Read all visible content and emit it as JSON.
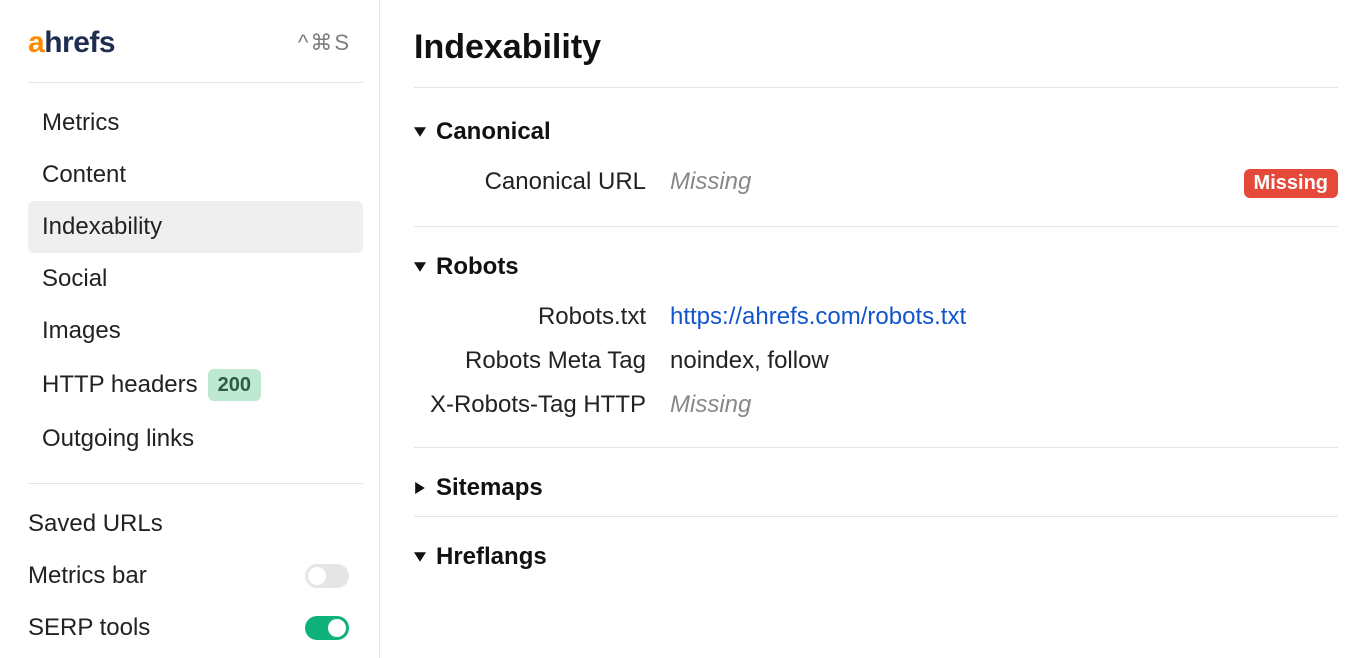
{
  "sidebar": {
    "shortcut_hint": "^⌘S",
    "items": [
      {
        "label": "Metrics",
        "active": false
      },
      {
        "label": "Content",
        "active": false
      },
      {
        "label": "Indexability",
        "active": true
      },
      {
        "label": "Social",
        "active": false
      },
      {
        "label": "Images",
        "active": false
      },
      {
        "label": "HTTP headers",
        "active": false,
        "badge": "200"
      },
      {
        "label": "Outgoing links",
        "active": false
      }
    ],
    "bottom_items": [
      {
        "label": "Saved URLs",
        "has_toggle": false
      },
      {
        "label": "Metrics bar",
        "has_toggle": true,
        "toggle_on": false
      },
      {
        "label": "SERP tools",
        "has_toggle": true,
        "toggle_on": true
      }
    ]
  },
  "main": {
    "title": "Indexability",
    "sections": [
      {
        "title": "Canonical",
        "expanded": true,
        "rows": [
          {
            "key": "Canonical URL",
            "value": "Missing",
            "missing": true,
            "badge": "Missing"
          }
        ]
      },
      {
        "title": "Robots",
        "expanded": true,
        "rows": [
          {
            "key": "Robots.txt",
            "value": "https://ahrefs.com/robots.txt",
            "is_link": true
          },
          {
            "key": "Robots Meta Tag",
            "value": "noindex, follow"
          },
          {
            "key": "X-Robots-Tag HTTP",
            "value": "Missing",
            "missing": true
          }
        ]
      },
      {
        "title": "Sitemaps",
        "expanded": false,
        "rows": []
      },
      {
        "title": "Hreflangs",
        "expanded": true,
        "rows": []
      }
    ]
  }
}
